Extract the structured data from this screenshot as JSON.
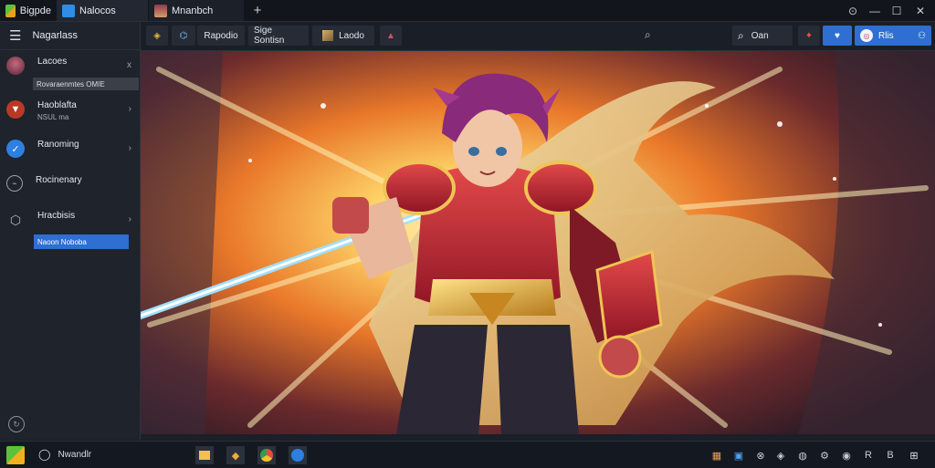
{
  "titlebar": {
    "tabs": [
      {
        "label": "Bigpde"
      },
      {
        "label": "Nalocos"
      },
      {
        "label": "Mnanbch"
      }
    ],
    "new_tab": "+",
    "window_controls": {
      "status": "⊙",
      "minimize": "—",
      "maximize": "☐",
      "close": "✕"
    }
  },
  "sidebar": {
    "menu_icon": "hamburger-icon",
    "title": "Nagarlass",
    "items": [
      {
        "label": "Lacoes",
        "sub": "",
        "icon": "avatar",
        "chevron": "x",
        "highlight": "Rovaraenmtes OMIE"
      },
      {
        "label": "Haoblafta",
        "sub": "NSUL ma",
        "icon": "shield-red-icon",
        "chevron": "›"
      },
      {
        "label": "Ranoming",
        "sub": "",
        "icon": "blue-check-icon",
        "chevron": "›"
      },
      {
        "label": "Rocinenary",
        "sub": "",
        "icon": "bookmark-icon",
        "chevron": ""
      },
      {
        "label": "Hracbisis",
        "sub": "",
        "icon": "shield-outline-icon",
        "chevron": "›",
        "highlight": "Naoon Noboba"
      }
    ],
    "bottom_icon": "settings-icon"
  },
  "toolbar": {
    "buttons": [
      "Rapodio",
      "Sige Sontisn",
      "Laodo"
    ],
    "search_value": "Oan",
    "user_label": "Rlis",
    "colors": {
      "accent": "#2e6fd1"
    }
  },
  "taskbar": {
    "search_label": "Nwandlr",
    "apps": [
      "folder-icon",
      "save-icon",
      "pin-icon",
      "chrome-icon",
      "browser-icon"
    ],
    "tray": [
      "grid-icon",
      "network-icon",
      "alert-icon",
      "chat-icon",
      "settings-icon",
      "shield-icon",
      "lang-icon",
      "display-icon",
      "power-icon"
    ],
    "tray_labels": [
      "R",
      "B"
    ]
  }
}
